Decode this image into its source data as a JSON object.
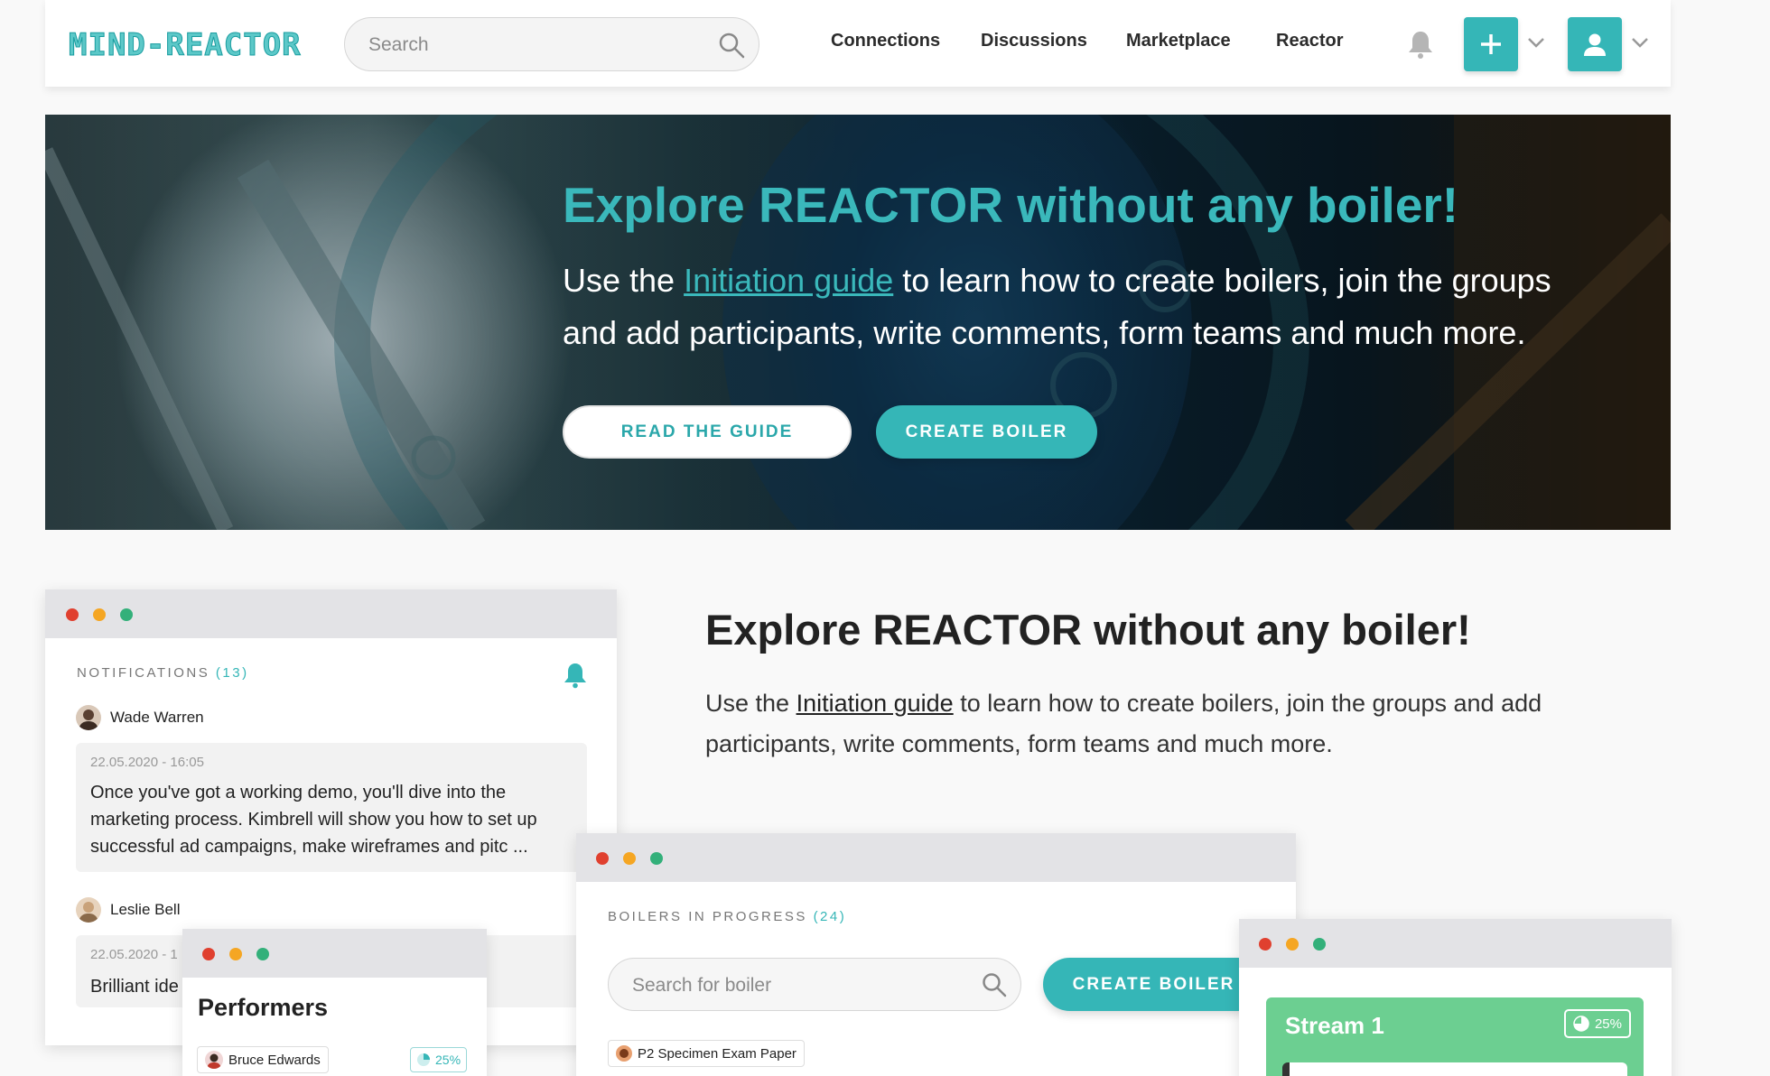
{
  "nav": {
    "logo": "MIND-REACTOR",
    "search_placeholder": "Search",
    "links": [
      "Connections",
      "Discussions",
      "Marketplace",
      "Reactor"
    ],
    "icons": [
      "bell-icon",
      "plus-icon",
      "user-icon",
      "chevron-down-icon"
    ]
  },
  "hero": {
    "title": "Explore REACTOR without any boiler!",
    "text_before": "Use the ",
    "link": "Initiation guide",
    "text_after": " to learn how to create boilers, join the groups and add participants, write comments, form teams and much more.",
    "btn_guide": "READ THE GUIDE",
    "btn_create": "CREATE BOILER"
  },
  "section": {
    "title": "Explore REACTOR without any boiler!",
    "text_before": "Use the ",
    "link": "Initiation guide",
    "text_after": " to learn how to create boilers, join the groups and add participants, write comments, form teams and much more."
  },
  "notifications": {
    "label": "NOTIFICATIONS",
    "count": "(13)",
    "items": [
      {
        "name": "Wade Warren",
        "date": "22.05.2020 - 16:05",
        "text": "Once you've got a working demo, you'll dive into the marketing process. Kimbrell will show you how to set up successful ad campaigns, make wireframes and pitc ..."
      },
      {
        "name": "Leslie Bell",
        "date": "22.05.2020 - 1",
        "text": "Brilliant ide"
      }
    ]
  },
  "performers": {
    "title": "Performers",
    "person": "Bruce Edwards",
    "percent": "25%"
  },
  "boilers": {
    "label": "BOILERS IN PROGRESS",
    "count": "(24)",
    "search_placeholder": "Search for boiler",
    "create_label": "CREATE BOILER",
    "item": "P2 Specimen Exam Paper"
  },
  "stream": {
    "title": "Stream 1",
    "percent": "25%"
  },
  "colors": {
    "accent": "#35b6b7",
    "stream_green": "#6ccf91",
    "dot_red": "#e0402f",
    "dot_yellow": "#f5a623",
    "dot_green": "#33b07a"
  }
}
